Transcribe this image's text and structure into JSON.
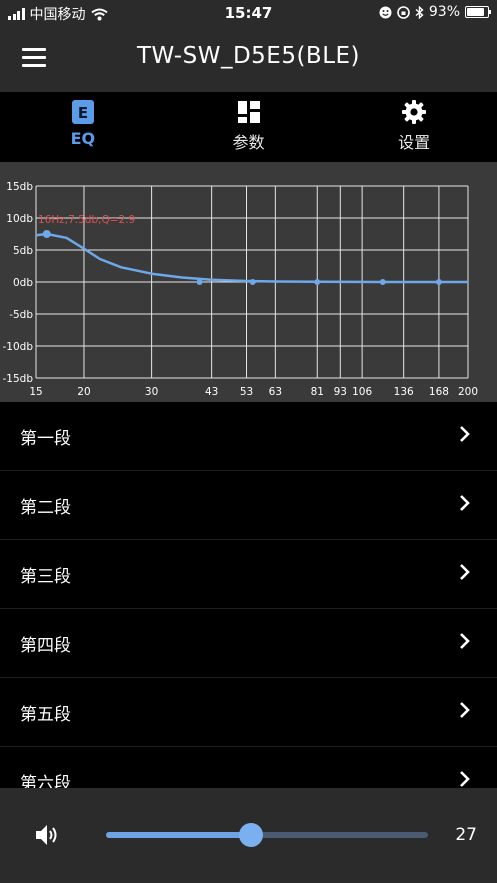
{
  "status": {
    "carrier": "中国移动",
    "time": "15:47",
    "battery": "93%",
    "battery_level": 0.93
  },
  "header": {
    "title": "TW-SW_D5E5(BLE)",
    "menu_icon": "hamburger-menu-icon"
  },
  "tabs": [
    {
      "label": "EQ",
      "icon": "eq-icon",
      "active": true
    },
    {
      "label": "参数",
      "icon": "dashboard-icon",
      "active": false
    },
    {
      "label": "设置",
      "icon": "gear-icon",
      "active": false
    }
  ],
  "chart_data": {
    "type": "line",
    "y_ticks": [
      "15db",
      "10db",
      "5db",
      "0db",
      "-5db",
      "-10db",
      "-15db"
    ],
    "ylim": [
      -15,
      15
    ],
    "x_ticks": [
      "15",
      "20",
      "30",
      "43",
      "53",
      "63",
      "81",
      "93",
      "106",
      "136",
      "168",
      "200"
    ],
    "x_tick_values": [
      15,
      20,
      30,
      43,
      53,
      63,
      81,
      93,
      106,
      136,
      168,
      200
    ],
    "xlim": [
      15,
      200
    ],
    "annotation": "16Hz,7.5db,Q=2.9",
    "line_color": "#6ea8e8",
    "grid": true,
    "series": [
      {
        "x": [
          15,
          16,
          18,
          20,
          22,
          25,
          30,
          36,
          43,
          53,
          63,
          81,
          100,
          136,
          168,
          200
        ],
        "y": [
          7.3,
          7.5,
          6.9,
          5.2,
          3.6,
          2.3,
          1.3,
          0.7,
          0.35,
          0.15,
          0.08,
          0.03,
          0.01,
          0,
          0,
          0
        ]
      }
    ],
    "points": [
      {
        "x": 16,
        "y": 7.5
      },
      {
        "x": 40,
        "y": 0
      },
      {
        "x": 55,
        "y": 0
      },
      {
        "x": 81,
        "y": 0
      },
      {
        "x": 120,
        "y": 0
      },
      {
        "x": 168,
        "y": 0
      }
    ]
  },
  "bands": [
    "第一段",
    "第二段",
    "第三段",
    "第四段",
    "第五段",
    "第六段"
  ],
  "volume": {
    "icon": "speaker-icon",
    "value": "27",
    "level": 0.45
  },
  "colors": {
    "accent": "#5b9be8",
    "bar": "#2b2b2b",
    "chart_bg": "#3a3a3a"
  }
}
